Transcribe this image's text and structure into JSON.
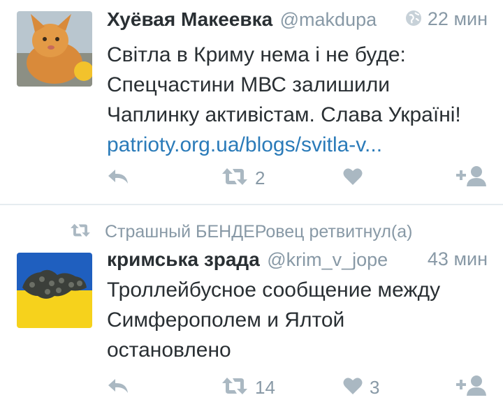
{
  "tweets": [
    {
      "name": "Хуёвая Макеевка",
      "handle": "@makdupa",
      "time": "22 мин",
      "text_lines": [
        "Світла в Криму нема і не буде:",
        "Спецчастини МВС залишили",
        "Чаплинку активістам. Слава Україні!"
      ],
      "link": "patrioty.org.ua/blogs/svitla-v...",
      "retweet_count": "2",
      "like_count": ""
    },
    {
      "retweeted_by": "Страшный БЕНДЕРовец ретвитнул(а)",
      "name": "кримська зрада",
      "handle": "@krim_v_jope",
      "time": "43 мин",
      "text_lines": [
        "Троллейбусное сообщение между",
        "Симферополем и Ялтой",
        "остановлено"
      ],
      "retweet_count": "14",
      "like_count": "3"
    }
  ],
  "colors": {
    "muted": "#8899a6",
    "link": "#2b7bb9",
    "text": "#292f33",
    "divider": "#e6ecf0"
  },
  "icons": [
    "globe-icon",
    "reply-icon",
    "retweet-icon",
    "like-icon",
    "follow-icon"
  ]
}
